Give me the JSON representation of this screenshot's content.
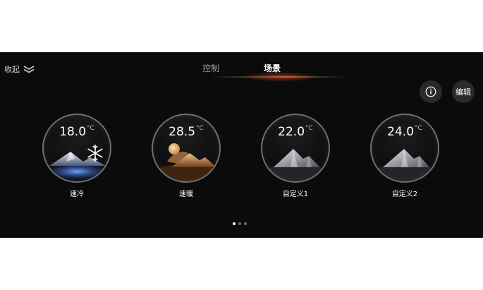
{
  "header": {
    "collapse_label": "收起",
    "tabs": [
      {
        "label": "控制",
        "active": false
      },
      {
        "label": "场景",
        "active": true
      }
    ],
    "accent_color": "#e25728"
  },
  "actions": {
    "info_icon": "info-icon",
    "edit_label": "编辑"
  },
  "scenes": [
    {
      "temp": "18.0",
      "unit": "°C",
      "label": "速冷",
      "icon": "snowflake-icon"
    },
    {
      "temp": "28.5",
      "unit": "°C",
      "label": "速暖",
      "icon": "sun-icon"
    },
    {
      "temp": "22.0",
      "unit": "°C",
      "label": "自定义1",
      "icon": "mountain-icon"
    },
    {
      "temp": "24.0",
      "unit": "°C",
      "label": "自定义2",
      "icon": "mountain-icon"
    }
  ],
  "pagination": {
    "pages": 3,
    "current": 1
  }
}
